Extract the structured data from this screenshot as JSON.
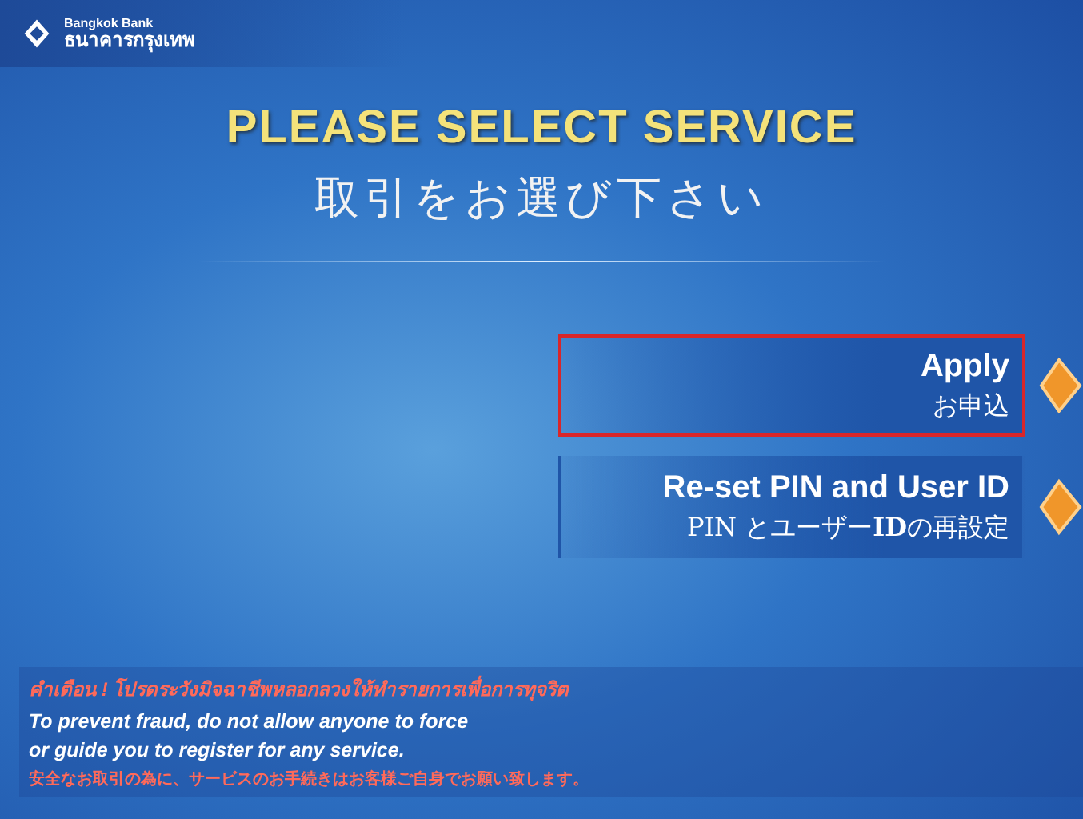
{
  "header": {
    "logo_text_en": "Bangkok Bank",
    "logo_text_th": "ธนาคารกรุงเทพ"
  },
  "title": "PLEASE SELECT SERVICE",
  "subtitle": "取引をお選び下さい",
  "options": [
    {
      "label": "Apply",
      "sublabel": "お申込",
      "selected": true
    },
    {
      "label": "Re-set PIN and User ID",
      "sublabel": "PIN とユーザー**ID**の再設定",
      "selected": false
    }
  ],
  "warning": {
    "thai": "คำเตือน ! โปรดระวังมิจฉาชีพหลอกลวงให้ทำรายการเพื่อการทุจริต",
    "english": [
      "To prevent fraud, do not allow anyone to force",
      "or guide you to register for any service."
    ],
    "japanese": "安全なお取引の為に、サービスのお手続きはお客様ご自身でお願い致します。"
  }
}
